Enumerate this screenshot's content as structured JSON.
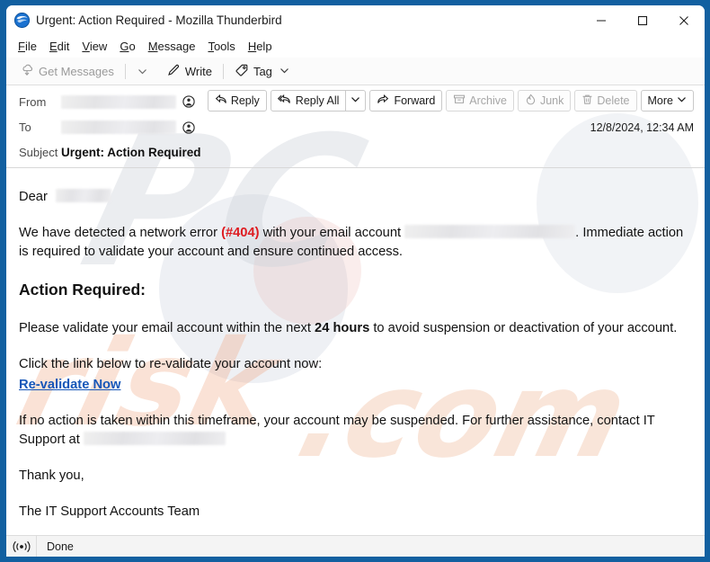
{
  "window": {
    "title": "Urgent: Action Required - Mozilla Thunderbird",
    "app_icon": "thunderbird-logo-icon",
    "frame_color": "#1260a0",
    "controls": [
      {
        "name": "minimize-button",
        "glyph": "minimize-icon"
      },
      {
        "name": "maximize-button",
        "glyph": "maximize-icon"
      },
      {
        "name": "close-button",
        "glyph": "close-icon"
      }
    ]
  },
  "menubar": {
    "items": [
      {
        "label": "File",
        "accel": "F"
      },
      {
        "label": "Edit",
        "accel": "E"
      },
      {
        "label": "View",
        "accel": "V"
      },
      {
        "label": "Go",
        "accel": "G"
      },
      {
        "label": "Message",
        "accel": "M"
      },
      {
        "label": "Tools",
        "accel": "T"
      },
      {
        "label": "Help",
        "accel": "H"
      }
    ]
  },
  "toolbar": {
    "get_messages_label": "Get Messages",
    "get_messages_icon": "download-cloud-icon",
    "get_messages_disabled": true,
    "get_messages_chevron_icon": "chevron-down-icon",
    "write_label": "Write",
    "write_icon": "pencil-icon",
    "tag_label": "Tag",
    "tag_icon": "tag-icon",
    "tag_chevron_icon": "chevron-down-icon"
  },
  "message_header": {
    "from_label": "From",
    "from_value_redacted": true,
    "from_contact_icon": "contact-circle-icon",
    "to_label": "To",
    "to_value_redacted": true,
    "to_contact_icon": "contact-circle-icon",
    "subject_label": "Subject",
    "subject_value": "Urgent: Action Required",
    "date": "12/8/2024, 12:34 AM"
  },
  "message_actions": [
    {
      "name": "reply-button",
      "label": "Reply",
      "icon": "reply-arrow-icon",
      "disabled": false
    },
    {
      "name": "reply-all-button",
      "label": "Reply All",
      "icon": "reply-all-arrow-icon",
      "disabled": false
    },
    {
      "name": "reply-dropdown-button",
      "label": "",
      "icon": "chevron-down-icon",
      "disabled": false
    },
    {
      "name": "forward-button",
      "label": "Forward",
      "icon": "forward-arrow-icon",
      "disabled": false
    },
    {
      "name": "archive-button",
      "label": "Archive",
      "icon": "archive-box-icon",
      "disabled": true
    },
    {
      "name": "junk-button",
      "label": "Junk",
      "icon": "flame-icon",
      "disabled": true
    },
    {
      "name": "delete-button",
      "label": "Delete",
      "icon": "trash-icon",
      "disabled": true
    },
    {
      "name": "more-button",
      "label": "More",
      "icon": "chevron-down-icon",
      "disabled": false
    }
  ],
  "email_body": {
    "greeting": "Dear",
    "greeting_redacted": true,
    "para1_a": "We have detected a network error ",
    "para1_error_code": "(#404)",
    "para1_b": " with your email account ",
    "para1_account_redacted": true,
    "para1_c": ". Immediate action is required to validate your account and ensure continued access.",
    "heading": "Action Required:",
    "para2_a": "Please validate your email account within the next ",
    "para2_bold": "24 hours",
    "para2_b": " to avoid suspension or deactivation of your account.",
    "para3": "Click the link below to re-validate your account now:",
    "link_label": "Re-validate Now",
    "para4_a": "If no action is taken within this timeframe, your account may be suspended. For further assistance, contact IT Support at ",
    "para4_email_redacted": true,
    "signoff_line1": "Thank you,",
    "signoff_line2": "The IT Support Accounts Team",
    "error_color": "#de1b20",
    "link_color": "#1757b8"
  },
  "statusbar": {
    "connection_icon": "online-broadcast-icon",
    "status_text": "Done"
  },
  "watermark": {
    "text_1": "PC",
    "text_2": "risk",
    "text_3": ".com"
  }
}
